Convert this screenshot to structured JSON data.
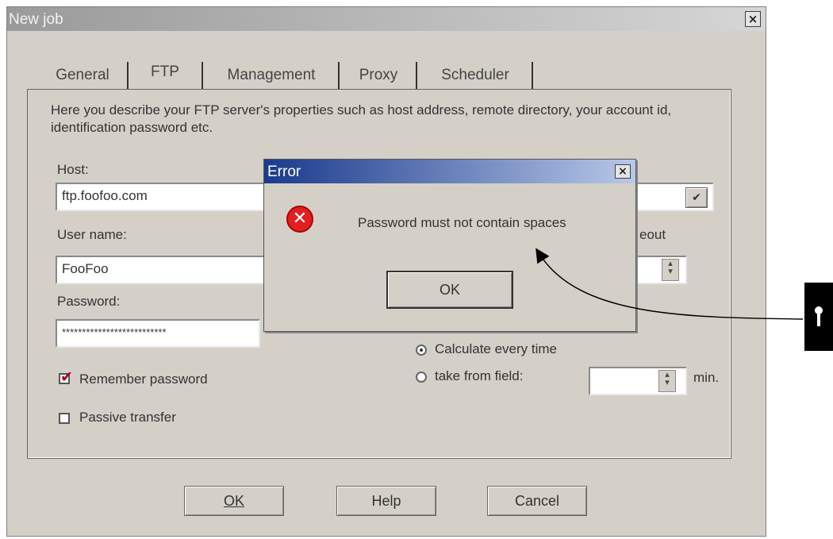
{
  "window": {
    "title": "New job",
    "close_glyph": "×"
  },
  "tabs": [
    {
      "label": "General",
      "active": false
    },
    {
      "label": "FTP",
      "active": true
    },
    {
      "label": "Management",
      "active": false
    },
    {
      "label": "Proxy",
      "active": false
    },
    {
      "label": "Scheduler",
      "active": false
    }
  ],
  "ftp": {
    "description": "Here you describe your FTP server's properties such as host address, remote directory, your account id, identification password etc.",
    "host_label": "Host:",
    "host_value": "ftp.foofoo.com",
    "username_label": "User name:",
    "username_value": "FooFoo",
    "password_label": "Password:",
    "password_value": "**************************",
    "remember_password_label": "Remember password",
    "remember_password_checked": true,
    "passive_transfer_label": "Passive transfer",
    "passive_transfer_checked": false,
    "timeout_label_fragment": "eout",
    "calc_every_time_label": "Calculate every time",
    "take_from_field_label": "take from field:",
    "min_label": "min.",
    "timeout_option_selected": "Calculate every time"
  },
  "buttons": {
    "ok": "OK",
    "help": "Help",
    "cancel": "Cancel"
  },
  "error_dialog": {
    "title": "Error",
    "message": "Password must not contain spaces",
    "ok": "OK",
    "icon": "error-x-icon",
    "close_glyph": "×"
  },
  "colors": {
    "error_title": "#1a3a8c",
    "error_icon": "#e02020",
    "window_bg": "#d4d0c8"
  }
}
